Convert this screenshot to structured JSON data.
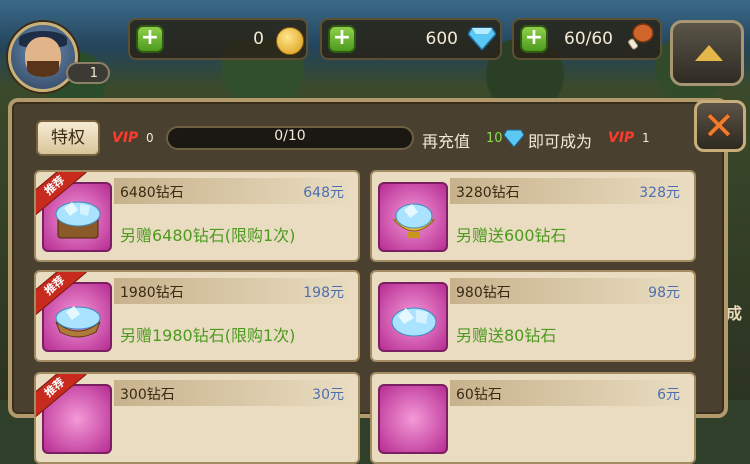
{
  "hud": {
    "level": "1",
    "gold": "0",
    "gems": "600",
    "stamina": "60/60"
  },
  "vip_bar": {
    "privilege_label": "特权",
    "vip_text": "VIP",
    "current_vip": "0",
    "progress_text": "0/10",
    "progress_fraction": 0,
    "recharge_prefix": "再充值",
    "recharge_amount": "10",
    "recharge_suffix": "即可成为",
    "next_vip": "1"
  },
  "cards": [
    {
      "name": "6480钻石",
      "price": "648元",
      "bonus": "另赠6480钻石(限购1次)",
      "tag": "推荐"
    },
    {
      "name": "3280钻石",
      "price": "328元",
      "bonus": "另赠送600钻石",
      "tag": ""
    },
    {
      "name": "1980钻石",
      "price": "198元",
      "bonus": "另赠1980钻石(限购1次)",
      "tag": "推荐"
    },
    {
      "name": "980钻石",
      "price": "98元",
      "bonus": "另赠送80钻石",
      "tag": ""
    },
    {
      "name": "300钻石",
      "price": "30元",
      "bonus": "",
      "tag": "推荐"
    },
    {
      "name": "60钻石",
      "price": "6元",
      "bonus": "",
      "tag": ""
    }
  ],
  "background": {
    "side_text": "成"
  },
  "colors": {
    "vip_red": "#ff3a2a",
    "bonus_green": "#4c9a1e",
    "price_blue": "#4d6fb1",
    "close_orange": "#f07d2c"
  },
  "icons": [
    "plus-icon",
    "gold-coin-icon",
    "diamond-icon",
    "meat-leg-icon",
    "arrow-up-icon",
    "close-icon",
    "diamond-pile-icon"
  ]
}
